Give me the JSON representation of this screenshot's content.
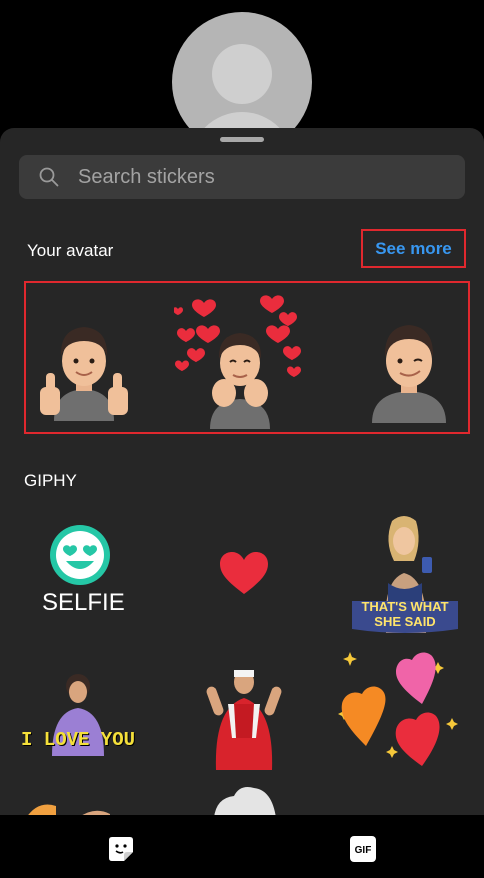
{
  "search": {
    "placeholder": "Search stickers"
  },
  "avatar_section": {
    "title": "Your avatar",
    "see_more_label": "See more",
    "stickers": [
      "avatar-thumbs-up",
      "avatar-hearts",
      "avatar-wink"
    ]
  },
  "giphy_section": {
    "title": "GIPHY",
    "stickers": [
      {
        "name": "selfie",
        "caption": "SELFIE"
      },
      {
        "name": "red-heart",
        "caption": ""
      },
      {
        "name": "thats-what-she-said",
        "caption_line1": "THAT'S WHAT",
        "caption_line2": "SHE SAID"
      },
      {
        "name": "i-love-you",
        "caption": "I LOVE YOU"
      },
      {
        "name": "fan-red-scarf",
        "caption": ""
      },
      {
        "name": "hearts-stickers",
        "caption": ""
      }
    ]
  },
  "bottom_tabs": [
    {
      "name": "stickers",
      "icon": "sticker-icon"
    },
    {
      "name": "gif",
      "icon": "gif-icon",
      "label": "GIF"
    }
  ],
  "colors": {
    "sheet_bg": "#262626",
    "search_bg": "#3b3b3b",
    "link_blue": "#3897f0",
    "highlight_red": "#e0282e"
  }
}
